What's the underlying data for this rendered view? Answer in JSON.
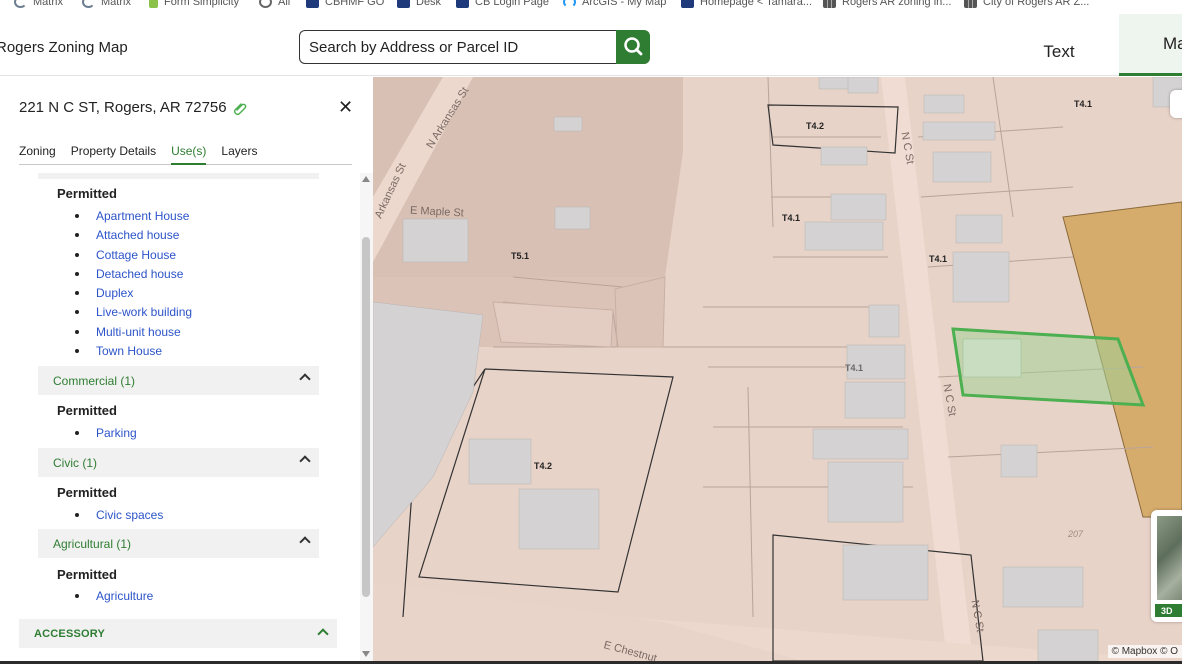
{
  "bookmarks": [
    {
      "label": "Matrix",
      "icon": "matrix-icon"
    },
    {
      "label": "Matrix",
      "icon": "matrix-icon"
    },
    {
      "label": "Form Simplicity",
      "icon": "document-icon"
    },
    {
      "label": "All",
      "icon": "globe-icon"
    },
    {
      "label": "CBHMF GO",
      "icon": "coldwell-banker-icon"
    },
    {
      "label": "Desk",
      "icon": "coldwell-banker-icon"
    },
    {
      "label": "CB Login Page",
      "icon": "coldwell-banker-icon"
    },
    {
      "label": "ArcGIS - My Map",
      "icon": "arcgis-icon"
    },
    {
      "label": "Homepage < Tamara...",
      "icon": "coldwell-banker-icon"
    },
    {
      "label": "Rogers AR zoning in...",
      "icon": "city-grid-icon"
    },
    {
      "label": "City of Rogers AR Z...",
      "icon": "city-grid-icon"
    }
  ],
  "header": {
    "app_title": "Rogers Zoning Map",
    "search_placeholder": "Search by Address or Parcel ID",
    "tab_text": "Text",
    "tab_map": "Ma"
  },
  "panel": {
    "address": "221 N C ST, Rogers, AR 72756",
    "tabs": [
      "Zoning",
      "Property Details",
      "Use(s)",
      "Layers"
    ],
    "active_tab": "Use(s)",
    "permitted_label": "Permitted",
    "residential_uses": [
      "Apartment House",
      "Attached house",
      "Cottage House",
      "Detached house",
      "Duplex",
      "Live-work building",
      "Multi-unit house",
      "Town House"
    ],
    "commercial": {
      "title": "Commercial (1)",
      "uses": [
        "Parking"
      ]
    },
    "civic": {
      "title": "Civic (1)",
      "uses": [
        "Civic spaces"
      ]
    },
    "agricultural": {
      "title": "Agricultural (1)",
      "uses": [
        "Agriculture"
      ]
    },
    "accessory_title": "ACCESSORY"
  },
  "map": {
    "zones": [
      "T4.2",
      "T4.1",
      "T4.1",
      "T4.1",
      "T5.1",
      "T4.2",
      "T4.1",
      "T4.1"
    ],
    "streets": [
      "N Arkansas St",
      "Arkansas St",
      "E Maple St",
      "N C St",
      "N C St",
      "N C St",
      "E Chestnut"
    ],
    "parcel_number": "207",
    "attribution": "© Mapbox © O",
    "mini_map_label": "3D",
    "colors": {
      "zone_base": "#e8d3c8",
      "zone_t5": "#d9c0b5",
      "road": "#f0dcd2",
      "commercial": "#d6ac6d",
      "selected": "#4caf50"
    }
  }
}
